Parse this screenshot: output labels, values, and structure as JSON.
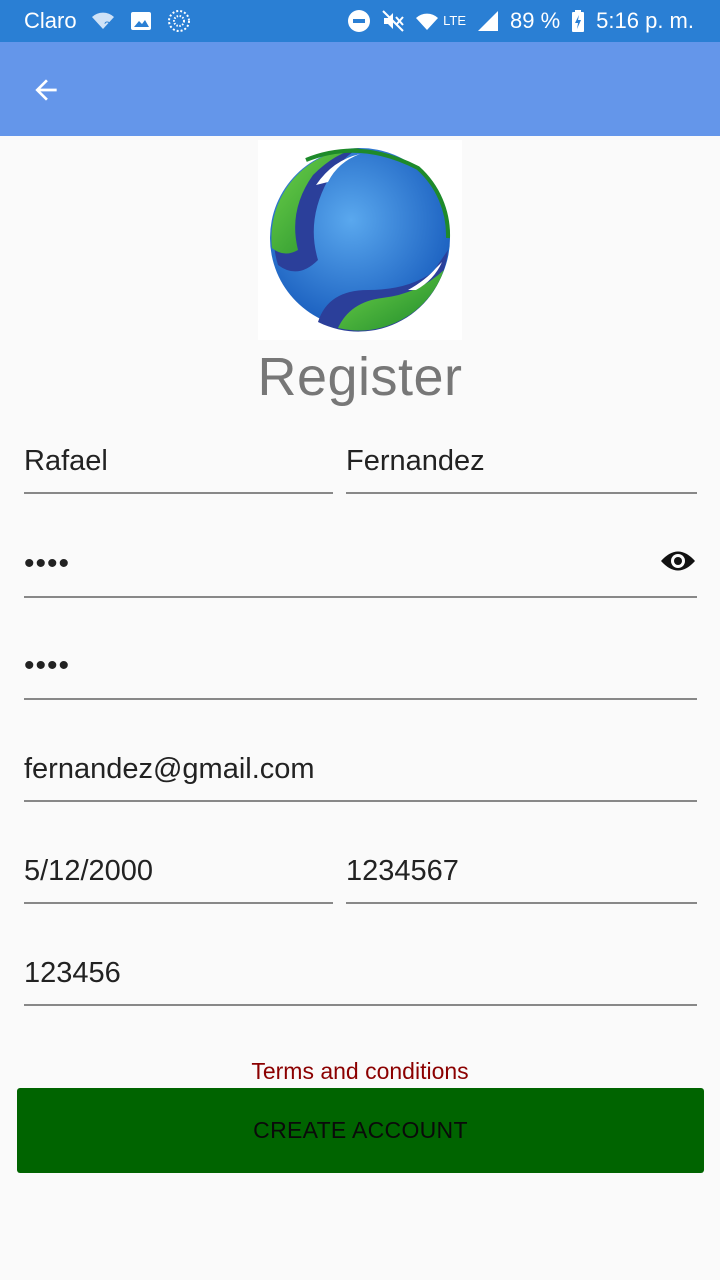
{
  "status_bar": {
    "carrier": "Claro",
    "network_type": "LTE",
    "battery": "89 %",
    "time": "5:16 p. m."
  },
  "app_bar": {
    "back_icon": "arrow-left-icon"
  },
  "form": {
    "title": "Register",
    "first_name": "Rafael",
    "last_name": "Fernandez",
    "password_mask": "••••",
    "confirm_password_mask": "••••",
    "email": "fernandez@gmail.com",
    "birth_date": "5/12/2000",
    "phone": "1234567",
    "document": "123456",
    "terms_link": "Terms and conditions",
    "create_button": "CREATE ACCOUNT"
  },
  "colors": {
    "status_bar": "#2a7fd4",
    "app_bar": "#6496ea",
    "button": "#006400",
    "terms": "#8b0000"
  }
}
